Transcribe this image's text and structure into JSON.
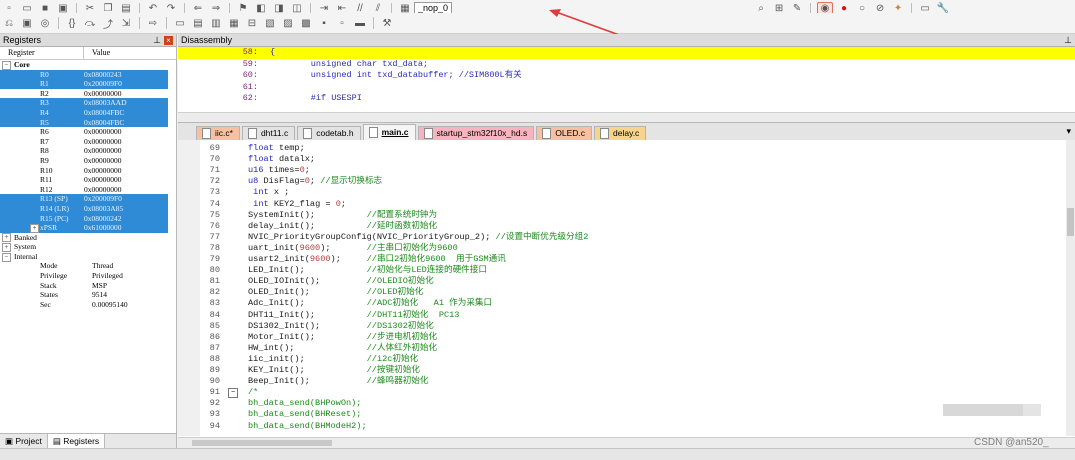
{
  "toolbar": {
    "target_combo": "_nop_0",
    "accent_arrow_color": "#e03c3c"
  },
  "registers_pane": {
    "title": "Registers",
    "col_register": "Register",
    "col_value": "Value",
    "core_label": "Core",
    "core_rows": [
      {
        "name": "R0",
        "value": "0x08000243",
        "selected": true
      },
      {
        "name": "R1",
        "value": "0x200009F0",
        "selected": true
      },
      {
        "name": "R2",
        "value": "0x00000000",
        "selected": false
      },
      {
        "name": "R3",
        "value": "0x08003AAD",
        "selected": true
      },
      {
        "name": "R4",
        "value": "0x08004FBC",
        "selected": true
      },
      {
        "name": "R5",
        "value": "0x08004FBC",
        "selected": true
      },
      {
        "name": "R6",
        "value": "0x00000000",
        "selected": false
      },
      {
        "name": "R7",
        "value": "0x00000000",
        "selected": false
      },
      {
        "name": "R8",
        "value": "0x00000000",
        "selected": false
      },
      {
        "name": "R9",
        "value": "0x00000000",
        "selected": false
      },
      {
        "name": "R10",
        "value": "0x00000000",
        "selected": false
      },
      {
        "name": "R11",
        "value": "0x00000000",
        "selected": false
      },
      {
        "name": "R12",
        "value": "0x00000000",
        "selected": false
      },
      {
        "name": "R13 (SP)",
        "value": "0x200009F0",
        "selected": true
      },
      {
        "name": "R14 (LR)",
        "value": "0x08003A85",
        "selected": true
      },
      {
        "name": "R15 (PC)",
        "value": "0x08000242",
        "selected": true
      },
      {
        "name": "xPSR",
        "value": "0x61000000",
        "selected": true
      }
    ],
    "banked_label": "Banked",
    "system_label": "System",
    "internal_label": "Internal",
    "internal_rows": [
      {
        "name": "Mode",
        "value": "Thread"
      },
      {
        "name": "Privilege",
        "value": "Privileged"
      },
      {
        "name": "Stack",
        "value": "MSP"
      },
      {
        "name": "States",
        "value": "9514"
      },
      {
        "name": "Sec",
        "value": "0.00095140"
      }
    ],
    "tab_project": "Project",
    "tab_registers": "Registers"
  },
  "disassembly": {
    "title": "Disassembly",
    "lines": [
      {
        "num": "58:",
        "code": "{",
        "current": true
      },
      {
        "num": "59:",
        "code": "        unsigned char txd_data;",
        "current": false
      },
      {
        "num": "60:",
        "code": "        unsigned int txd_databuffer; //SIM800L有关",
        "current": false
      },
      {
        "num": "61:",
        "code": "",
        "current": false
      },
      {
        "num": "62:",
        "code": "        #if USESPI",
        "current": false
      }
    ]
  },
  "file_tabs": [
    {
      "label": "iic.c*",
      "color": "#f7c0a0"
    },
    {
      "label": "dht11.c",
      "color": "#e3e3e3"
    },
    {
      "label": "codetab.h",
      "color": "#e3e3e3"
    },
    {
      "label": "main.c",
      "color": "#f5f5f5",
      "active": true
    },
    {
      "label": "startup_stm32f10x_hd.s",
      "color": "#f7b4c0"
    },
    {
      "label": "OLED.c",
      "color": "#f7c0a0"
    },
    {
      "label": "delay.c",
      "color": "#f7d48c"
    }
  ],
  "editor_lines": [
    {
      "num": "69",
      "code": "float temp;"
    },
    {
      "num": "70",
      "code": "float datalx;"
    },
    {
      "num": "71",
      "code": "u16 times=0;"
    },
    {
      "num": "72",
      "code": "u8 DisFlag=0; //显示切换标志"
    },
    {
      "num": "73",
      "code": " int x ;"
    },
    {
      "num": "74",
      "code": " int KEY2_flag = 0;"
    },
    {
      "num": "75",
      "code": "SystemInit();          //配置系统时钟为"
    },
    {
      "num": "76",
      "code": "delay_init();          //延时函数初始化"
    },
    {
      "num": "77",
      "code": "NVIC_PriorityGroupConfig(NVIC_PriorityGroup_2); //设置中断优先级分组2"
    },
    {
      "num": "78",
      "code": "uart_init(9600);       //主串口初始化为9600"
    },
    {
      "num": "79",
      "code": "usart2_init(9600);     //串口2初始化9600  用于GSM通讯"
    },
    {
      "num": "80",
      "code": "LED_Init();            //初始化与LED连接的硬件接口"
    },
    {
      "num": "81",
      "code": "OLED_IOInit();         //OLEDIO初始化"
    },
    {
      "num": "82",
      "code": "OLED_Init();           //OLED初始化"
    },
    {
      "num": "83",
      "code": "Adc_Init();            //ADC初始化   A1 作为采集口"
    },
    {
      "num": "84",
      "code": "DHT11_Init();          //DHT11初始化  PC13"
    },
    {
      "num": "85",
      "code": "DS1302_Init();         //DS1302初始化"
    },
    {
      "num": "86",
      "code": "Motor_Init();          //步进电机初始化"
    },
    {
      "num": "87",
      "code": "HW_int();              //人体红外初始化"
    },
    {
      "num": "88",
      "code": "iic_init();            //i2c初始化"
    },
    {
      "num": "89",
      "code": "KEY_Init();            //按键初始化"
    },
    {
      "num": "90",
      "code": "Beep_Init();           //蜂鸣器初始化"
    },
    {
      "num": "91",
      "code": "/*"
    },
    {
      "num": "92",
      "code": "bh_data_send(BHPowOn);"
    },
    {
      "num": "93",
      "code": "bh_data_send(BHReset);"
    },
    {
      "num": "94",
      "code": "bh_data_send(BHModeH2);"
    }
  ],
  "watermark": "CSDN @an520_"
}
